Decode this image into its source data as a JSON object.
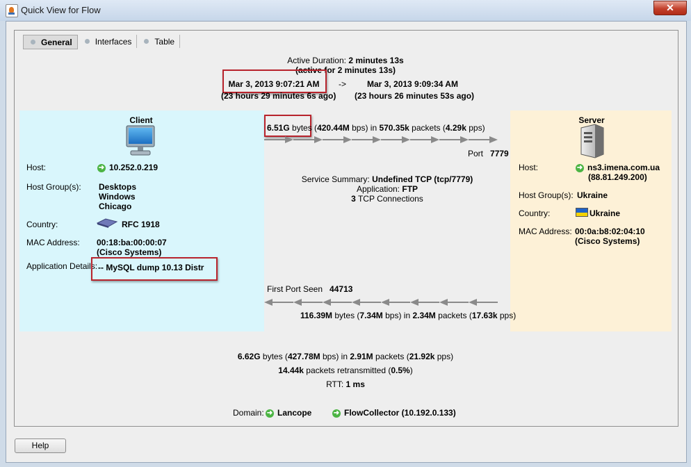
{
  "window": {
    "title": "Quick View for Flow",
    "close_label": "✕"
  },
  "tabs": [
    {
      "label": "General"
    },
    {
      "label": "Interfaces"
    },
    {
      "label": "Table"
    }
  ],
  "duration": {
    "label": "Active Duration:",
    "value": "2 minutes 13s",
    "active_note": "(active for 2 minutes 13s)",
    "start": "Mar 3, 2013 9:07:21 AM",
    "arrow": "->",
    "end": "Mar 3, 2013 9:09:34 AM",
    "start_ago": "(23 hours 29 minutes 6s ago)",
    "end_ago": "(23 hours 26 minutes 53s ago)"
  },
  "client": {
    "title": "Client",
    "host_label": "Host:",
    "host": "10.252.0.219",
    "host_group_label": "Host Group(s):",
    "host_groups": [
      "Desktops",
      "Windows",
      "Chicago"
    ],
    "country_label": "Country:",
    "country": "RFC 1918",
    "mac_label": "MAC Address:",
    "mac": "00:18:ba:00:00:07",
    "mac_vendor": "(Cisco Systems)",
    "app_details_label": "Application Details:",
    "app_details": "-- MySQL dump 10.13  Distr"
  },
  "server": {
    "title": "Server",
    "host_label": "Host:",
    "host": "ns3.imena.com.ua",
    "host_ip": "(88.81.249.200)",
    "host_group_label": "Host Group(s):",
    "host_group": "Ukraine",
    "country_label": "Country:",
    "country": "Ukraine",
    "mac_label": "MAC Address:",
    "mac": "00:0a:b8:02:04:10",
    "mac_vendor": "(Cisco Systems)"
  },
  "forward": {
    "bytes": "6.51G",
    "bytes_unit": " bytes (",
    "bps": "420.44M",
    "bps_unit": " bps) in ",
    "packets": "570.35k",
    "packets_unit": " packets (",
    "pps": "4.29k",
    "pps_unit": " pps)",
    "port_label": "Port",
    "port": "7779"
  },
  "service": {
    "summary_label": "Service Summary:",
    "summary": "Undefined TCP (tcp/7779)",
    "app_label": "Application:",
    "app": "FTP",
    "connections": "3",
    "connections_label": " TCP Connections"
  },
  "reverse": {
    "first_port_label": "First Port Seen",
    "first_port": "44713",
    "bytes": "116.39M",
    "bytes_unit": " bytes (",
    "bps": "7.34M",
    "bps_unit": " bps) in ",
    "packets": "2.34M",
    "packets_unit": " packets (",
    "pps": "17.63k",
    "pps_unit": " pps)"
  },
  "totals": {
    "bytes": "6.62G",
    "bytes_unit": " bytes (",
    "bps": "427.78M",
    "bps_unit": " bps) in ",
    "packets": "2.91M",
    "packets_unit": " packets (",
    "pps": "21.92k",
    "pps_unit": " pps)",
    "retrans": "14.44k",
    "retrans_unit": " packets retransmitted (",
    "retrans_pct": "0.5%",
    "retrans_close": ")",
    "rtt_label": "RTT:",
    "rtt": "1 ms"
  },
  "domain": {
    "label": "Domain:",
    "domain": "Lancope",
    "collector": "FlowCollector (10.192.0.133)"
  },
  "footer": {
    "help_label": "Help"
  },
  "colors": {
    "client_bg": "#d9f6fc",
    "server_bg": "#fdf1d7",
    "highlight": "#b8232c",
    "arrow": "#8a8a8a",
    "go_icon": "#4cb444"
  }
}
